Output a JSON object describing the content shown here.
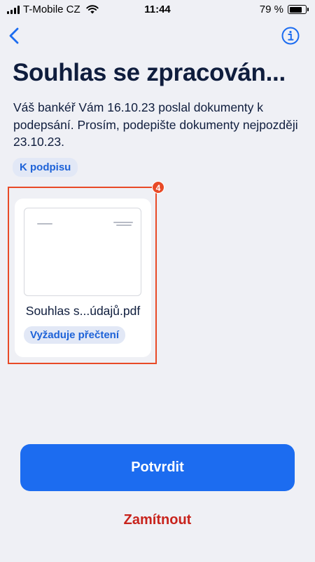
{
  "status_bar": {
    "carrier": "T-Mobile CZ",
    "time": "11:44",
    "battery_text": "79 %",
    "battery_level": 0.79
  },
  "nav": {
    "back_icon": "chevron-left-icon",
    "info_icon": "info-circle-icon"
  },
  "title": "Souhlas se zpracován...",
  "description": "Váš bankéř Vám 16.10.23 poslal dokumenty k podepsání. Prosím, podepište dokumenty nejpozději 23.10.23.",
  "section_chip": "K podpisu",
  "annotation_badge": "4",
  "document": {
    "name": "Souhlas s...údajů.pdf",
    "status": "Vyžaduje přečtení"
  },
  "actions": {
    "confirm": "Potvrdit",
    "reject": "Zamítnout"
  },
  "colors": {
    "background": "#eff0f5",
    "primary": "#1c6cf0",
    "danger": "#c8231c",
    "highlight": "#e84a27",
    "text": "#0f1d3d",
    "chip_bg": "#e2e8f6",
    "chip_text": "#1d62d8"
  }
}
